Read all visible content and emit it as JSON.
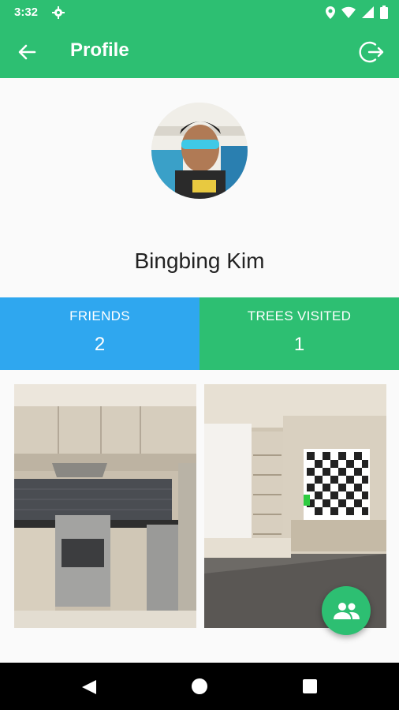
{
  "status_bar": {
    "time": "3:32"
  },
  "app_bar": {
    "title": "Profile"
  },
  "profile": {
    "name": "Bingbing Kim"
  },
  "stats": {
    "friends": {
      "label": "FRIENDS",
      "value": "2"
    },
    "trees": {
      "label": "TREES VISITED",
      "value": "1"
    }
  },
  "icons": {
    "back": "arrow-back-icon",
    "logout": "logout-icon",
    "fab": "people-icon"
  },
  "colors": {
    "primary": "#2dbf72",
    "friends_bg": "#2fa7ef",
    "background": "#fafafa"
  }
}
